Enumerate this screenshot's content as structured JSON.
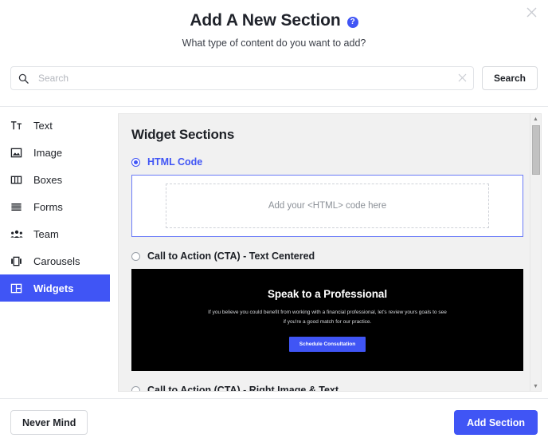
{
  "header": {
    "title": "Add A New Section",
    "help_icon": "question-circle-icon",
    "subtitle": "What type of content do you want to add?",
    "close_icon": "close-icon"
  },
  "search": {
    "icon": "search-icon",
    "value": "",
    "placeholder": "Search",
    "clear_icon": "clear-x-icon",
    "button_label": "Search"
  },
  "sidebar": {
    "items": [
      {
        "label": "Text",
        "icon": "text-format-icon",
        "active": false
      },
      {
        "label": "Image",
        "icon": "image-icon",
        "active": false
      },
      {
        "label": "Boxes",
        "icon": "boxes-columns-icon",
        "active": false
      },
      {
        "label": "Forms",
        "icon": "forms-lines-icon",
        "active": false
      },
      {
        "label": "Team",
        "icon": "team-people-icon",
        "active": false
      },
      {
        "label": "Carousels",
        "icon": "carousel-icon",
        "active": false
      },
      {
        "label": "Widgets",
        "icon": "widgets-grid-icon",
        "active": true
      }
    ]
  },
  "panel": {
    "title": "Widget Sections",
    "options": [
      {
        "label": "HTML Code",
        "selected": true,
        "preview_type": "html-drop",
        "dropzone_text": "Add your <HTML> code here"
      },
      {
        "label": "Call to Action (CTA) - Text Centered",
        "selected": false,
        "preview_type": "cta-dark",
        "cta": {
          "heading": "Speak to a Professional",
          "body": "If you believe you could benefit from working with a financial professional, let's review yours goals to see if you're a good match for our practice.",
          "button_label": "Schedule Consultation"
        }
      },
      {
        "label": "Call to Action (CTA) - Right Image & Text",
        "selected": false,
        "preview_type": "none"
      }
    ],
    "scrollbar": {
      "up_arrow": "chevron-up-icon",
      "down_arrow": "chevron-down-icon"
    }
  },
  "footer": {
    "cancel_label": "Never Mind",
    "submit_label": "Add Section"
  },
  "colors": {
    "accent": "#4055F5",
    "panel_bg": "#F1F1F1",
    "preview_bg": "#000000",
    "text": "#1D2026"
  }
}
